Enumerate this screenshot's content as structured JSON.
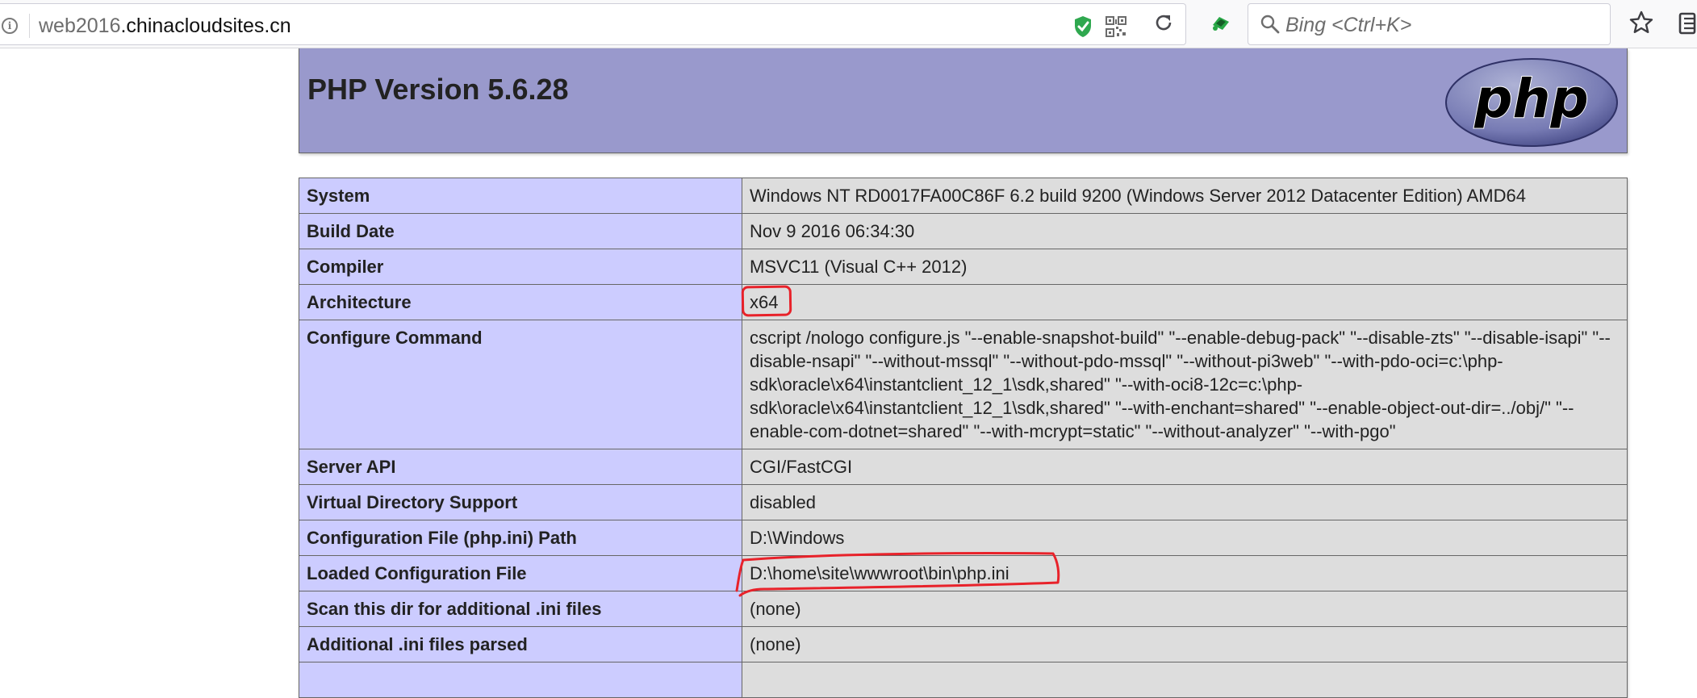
{
  "browser": {
    "url_host": "web2016",
    "url_domain": ".chinacloudsites.cn",
    "search_placeholder": "Bing <Ctrl+K>",
    "icons": [
      "info-icon",
      "shield-icon",
      "qr-code-icon",
      "reload-icon",
      "extension-icon",
      "search-icon",
      "bookmark-star-icon",
      "library-icon"
    ]
  },
  "page": {
    "title": "PHP Version 5.6.28",
    "logo_text": "php",
    "colors": {
      "header_bg": "#9999cc",
      "label_bg": "#ccccff",
      "value_bg": "#dddddd",
      "annotation": "#e8222a"
    },
    "rows": [
      {
        "label": "System",
        "value": "Windows NT RD0017FA00C86F 6.2 build 9200 (Windows Server 2012 Datacenter Edition) AMD64"
      },
      {
        "label": "Build Date",
        "value": "Nov 9 2016 06:34:30"
      },
      {
        "label": "Compiler",
        "value": "MSVC11 (Visual C++ 2012)"
      },
      {
        "label": "Architecture",
        "value": "x64",
        "highlighted": true
      },
      {
        "label": "Configure Command",
        "value": "cscript /nologo configure.js \"--enable-snapshot-build\" \"--enable-debug-pack\" \"--disable-zts\" \"--disable-isapi\" \"--disable-nsapi\" \"--without-mssql\" \"--without-pdo-mssql\" \"--without-pi3web\" \"--with-pdo-oci=c:\\php-sdk\\oracle\\x64\\instantclient_12_1\\sdk,shared\" \"--with-oci8-12c=c:\\php-sdk\\oracle\\x64\\instantclient_12_1\\sdk,shared\" \"--with-enchant=shared\" \"--enable-object-out-dir=../obj/\" \"--enable-com-dotnet=shared\" \"--with-mcrypt=static\" \"--without-analyzer\" \"--with-pgo\""
      },
      {
        "label": "Server API",
        "value": "CGI/FastCGI"
      },
      {
        "label": "Virtual Directory Support",
        "value": "disabled"
      },
      {
        "label": "Configuration File (php.ini) Path",
        "value": "D:\\Windows"
      },
      {
        "label": "Loaded Configuration File",
        "value": "D:\\home\\site\\wwwroot\\bin\\php.ini",
        "highlighted": true
      },
      {
        "label": "Scan this dir for additional .ini files",
        "value": "(none)"
      },
      {
        "label": "Additional .ini files parsed",
        "value": "(none)"
      }
    ]
  }
}
